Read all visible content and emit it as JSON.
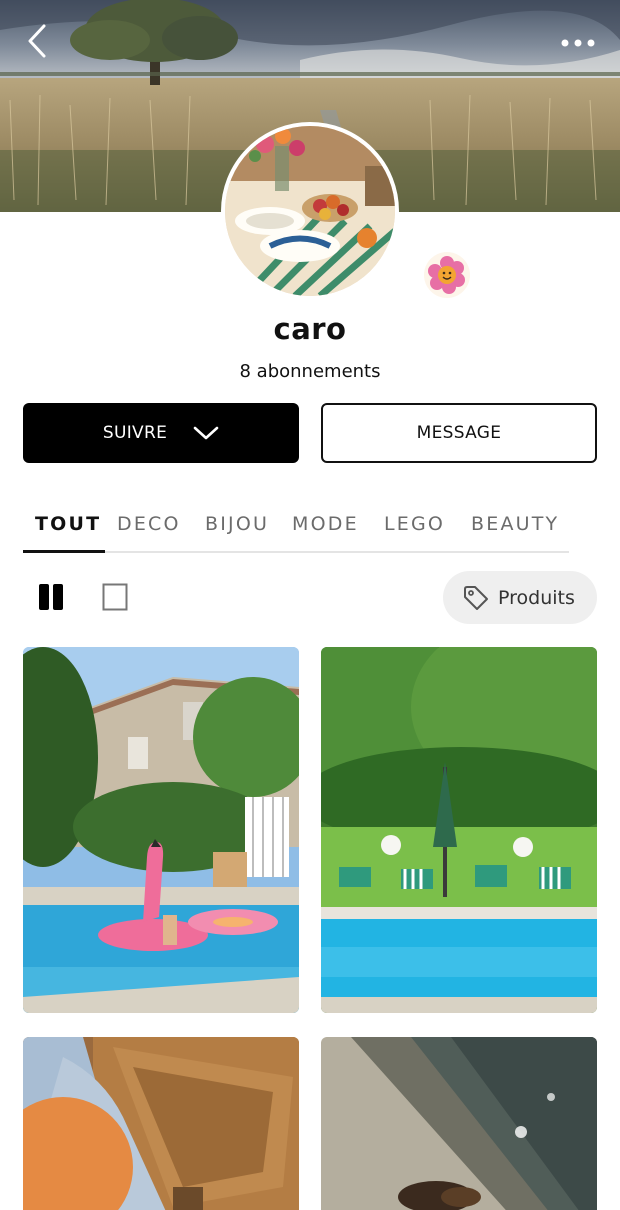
{
  "profile": {
    "username": "caro",
    "followers": "8 abonnements"
  },
  "actions": {
    "follow_label": "SUIVRE",
    "message_label": "MESSAGE"
  },
  "tabs": [
    {
      "label": "TOUT",
      "active": true
    },
    {
      "label": "DECO",
      "active": false
    },
    {
      "label": "BIJOU",
      "active": false
    },
    {
      "label": "MODE",
      "active": false
    },
    {
      "label": "LEGO",
      "active": false
    },
    {
      "label": "BEAUTY",
      "active": false
    }
  ],
  "view": {
    "mode": "grid",
    "products_label": "Produits"
  },
  "icons": {
    "back": "chevron-left-icon",
    "more": "more-horizontal-icon",
    "badge": "smiley-flower-icon",
    "follow_chevron": "chevron-down-icon",
    "grid": "grid-view-icon",
    "single": "single-view-icon",
    "tag": "tag-icon"
  },
  "colors": {
    "primary_button": "#000000",
    "tab_active": "#111111",
    "tab_inactive": "#6b6b6b",
    "pill_background": "#efefef"
  }
}
